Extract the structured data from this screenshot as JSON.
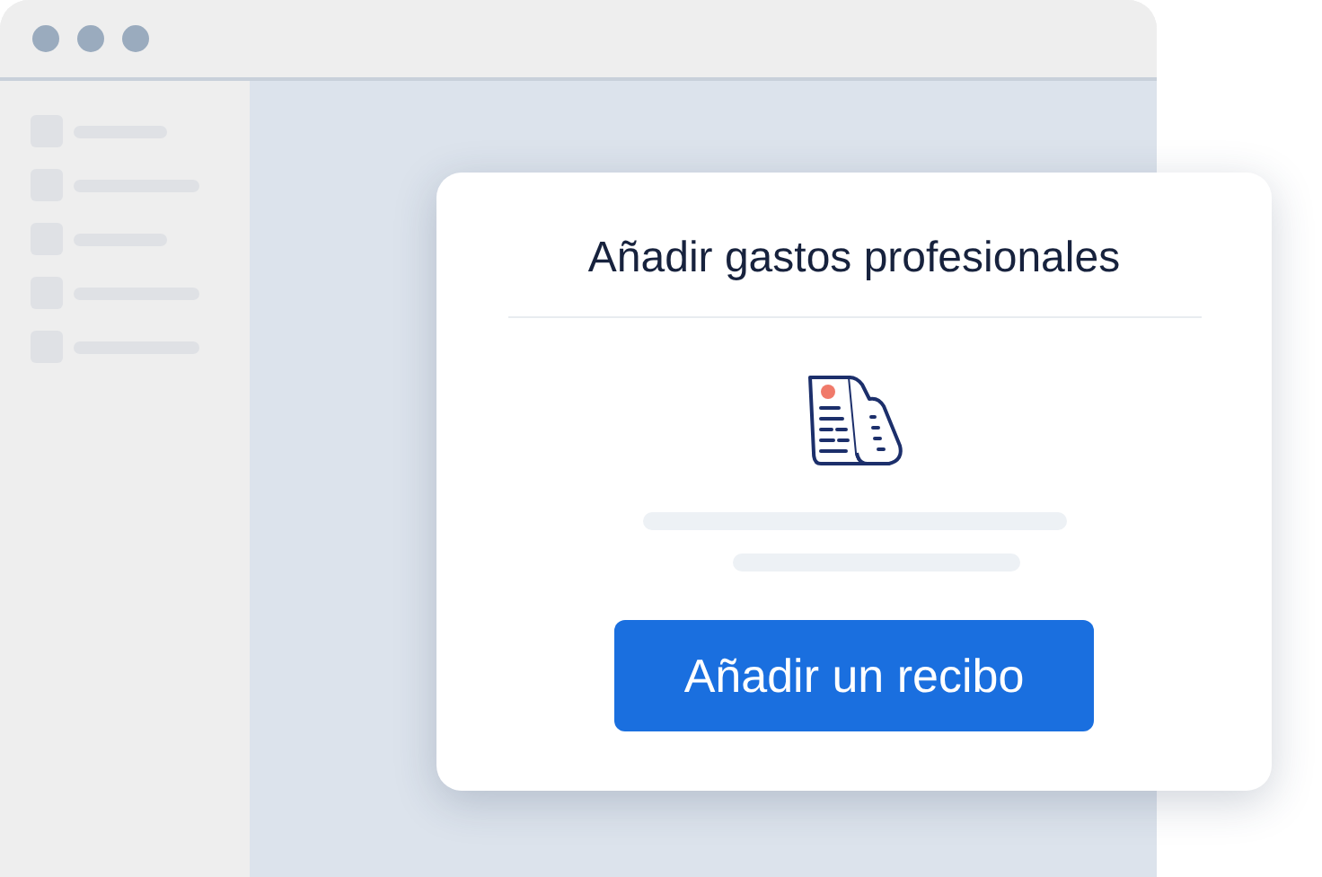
{
  "dialog": {
    "title": "Añadir gastos profesionales",
    "button": "Añadir un recibo"
  }
}
